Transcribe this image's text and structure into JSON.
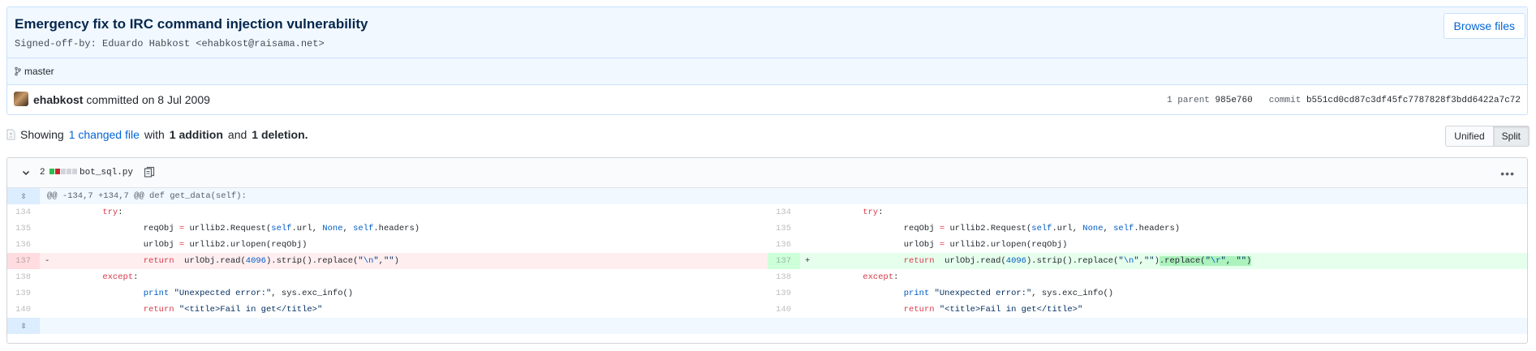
{
  "commit": {
    "title": "Emergency fix to IRC command injection vulnerability",
    "description": "Signed-off-by: Eduardo Habkost <ehabkost@raisama.net>",
    "browse_label": "Browse files",
    "branch": "master",
    "author": "ehabkost",
    "committed_text": "committed on 8 Jul 2009",
    "parent_label": "1 parent",
    "parent_sha": "985e760",
    "commit_label": "commit",
    "commit_sha": "b551cd0cd87c3df45fc7787828f3bdd6422a7c72"
  },
  "toc": {
    "showing": "Showing",
    "changed_files": "1 changed file",
    "with": "with",
    "additions": "1 addition",
    "and": "and",
    "deletions": "1 deletion.",
    "unified_label": "Unified",
    "split_label": "Split"
  },
  "file": {
    "diffstat_count": "2",
    "name": "bot_sql.py",
    "hunk_header": "@@ -134,7 +134,7 @@ def get_data(self):",
    "colors": {
      "add": "#2cbe4e",
      "del": "#cb2431",
      "neutral": "#d1d5da"
    },
    "left_lines": [
      {
        "num": "134",
        "sign": ""
      },
      {
        "num": "135",
        "sign": ""
      },
      {
        "num": "136",
        "sign": ""
      },
      {
        "num": "137",
        "sign": "-"
      },
      {
        "num": "138",
        "sign": ""
      },
      {
        "num": "139",
        "sign": ""
      },
      {
        "num": "140",
        "sign": ""
      }
    ],
    "right_lines": [
      {
        "num": "134",
        "sign": ""
      },
      {
        "num": "135",
        "sign": ""
      },
      {
        "num": "136",
        "sign": ""
      },
      {
        "num": "137",
        "sign": "+"
      },
      {
        "num": "138",
        "sign": ""
      },
      {
        "num": "139",
        "sign": ""
      },
      {
        "num": "140",
        "sign": ""
      }
    ]
  },
  "icons": [
    "branch-icon",
    "avatar",
    "file-diff-icon",
    "chevron-down-icon",
    "copy-icon",
    "kebab-icon",
    "expand-icon"
  ]
}
